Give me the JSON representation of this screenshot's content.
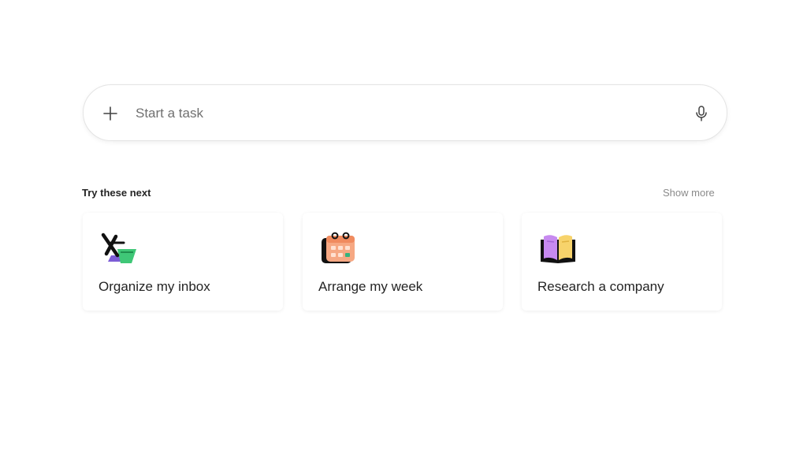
{
  "search": {
    "placeholder": "Start a task",
    "value": ""
  },
  "icons": {
    "add": "plus-icon",
    "voice": "microphone-icon"
  },
  "suggestions": {
    "title": "Try these next",
    "show_more_label": "Show more",
    "items": [
      {
        "label": "Organize my inbox",
        "icon": "inbox-organize-icon"
      },
      {
        "label": "Arrange my week",
        "icon": "calendar-icon"
      },
      {
        "label": "Research a company",
        "icon": "book-icon"
      }
    ]
  }
}
